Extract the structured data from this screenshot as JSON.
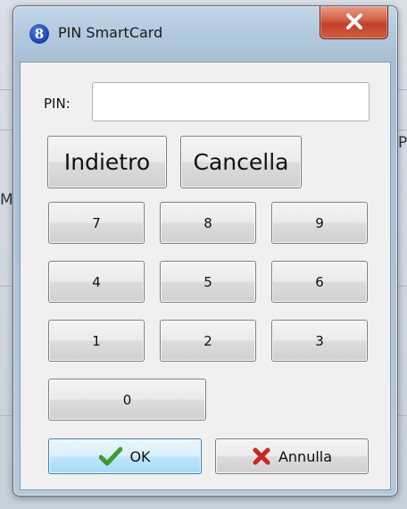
{
  "window": {
    "title": "PIN SmartCard",
    "app_icon_glyph": "8"
  },
  "background": {
    "fragment_right": "P",
    "fragment_left": "M"
  },
  "pin": {
    "label": "PIN:",
    "value": ""
  },
  "buttons": {
    "back": "Indietro",
    "clear": "Cancella",
    "digits": [
      "7",
      "8",
      "9",
      "4",
      "5",
      "6",
      "1",
      "2",
      "3",
      "0"
    ],
    "ok": "OK",
    "cancel": "Annulla"
  },
  "icons": {
    "close": "close-icon",
    "ok": "checkmark-icon",
    "cancel": "x-mark-icon",
    "app": "app-logo-icon"
  },
  "colors": {
    "ok_check": "#3c9a2e",
    "cancel_x": "#c8281e",
    "close_button": "#c7452c"
  }
}
